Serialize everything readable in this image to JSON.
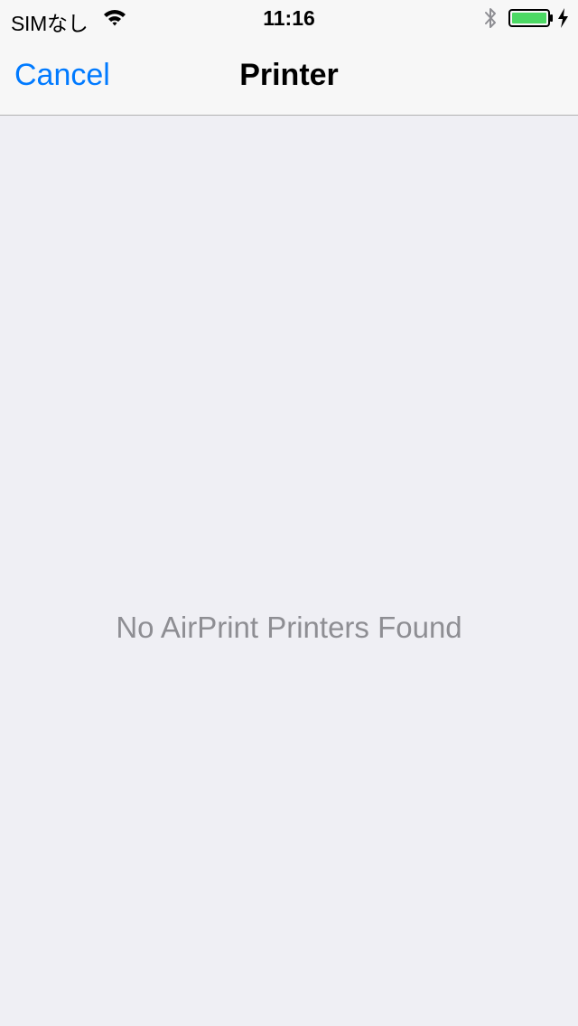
{
  "status_bar": {
    "carrier": "SIMなし",
    "time": "11:16",
    "icons": [
      "wifi-icon",
      "bluetooth-icon",
      "battery-icon",
      "charging-bolt-icon"
    ],
    "battery_color": "#4cd964"
  },
  "nav": {
    "cancel_label": "Cancel",
    "title": "Printer",
    "accent_color": "#007aff"
  },
  "content": {
    "empty_message": "No AirPrint Printers Found"
  }
}
